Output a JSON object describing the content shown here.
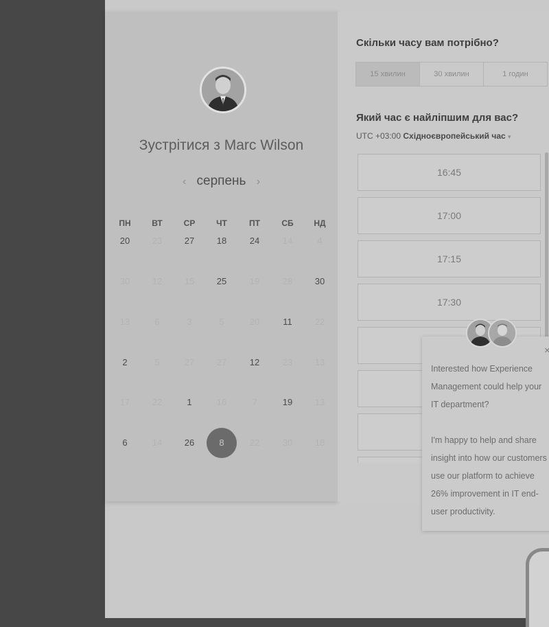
{
  "calendar": {
    "title": "Зустрітися з Marc Wilson",
    "month": "серпень",
    "prev_icon": "‹",
    "next_icon": "›",
    "weekdays": [
      "ПН",
      "ВТ",
      "СР",
      "ЧТ",
      "ПТ",
      "СБ",
      "НД"
    ],
    "rows": [
      [
        {
          "d": "20",
          "a": true
        },
        {
          "d": "23",
          "a": false
        },
        {
          "d": "27",
          "a": true
        },
        {
          "d": "18",
          "a": true
        },
        {
          "d": "24",
          "a": true
        },
        {
          "d": "14",
          "a": false
        },
        {
          "d": "4",
          "a": false
        }
      ],
      [
        {
          "d": "30",
          "a": false
        },
        {
          "d": "12",
          "a": false
        },
        {
          "d": "15",
          "a": false
        },
        {
          "d": "25",
          "a": true
        },
        {
          "d": "19",
          "a": false
        },
        {
          "d": "28",
          "a": false
        },
        {
          "d": "30",
          "a": true
        }
      ],
      [
        {
          "d": "13",
          "a": false
        },
        {
          "d": "6",
          "a": false
        },
        {
          "d": "3",
          "a": false
        },
        {
          "d": "5",
          "a": false
        },
        {
          "d": "20",
          "a": false
        },
        {
          "d": "11",
          "a": true
        },
        {
          "d": "22",
          "a": false
        }
      ],
      [
        {
          "d": "2",
          "a": true
        },
        {
          "d": "5",
          "a": false
        },
        {
          "d": "27",
          "a": false
        },
        {
          "d": "27",
          "a": false
        },
        {
          "d": "12",
          "a": true
        },
        {
          "d": "23",
          "a": false
        },
        {
          "d": "13",
          "a": false
        }
      ],
      [
        {
          "d": "17",
          "a": false
        },
        {
          "d": "22",
          "a": false
        },
        {
          "d": "1",
          "a": true
        },
        {
          "d": "16",
          "a": false
        },
        {
          "d": "7",
          "a": false
        },
        {
          "d": "19",
          "a": true
        },
        {
          "d": "13",
          "a": false
        }
      ],
      [
        {
          "d": "6",
          "a": true
        },
        {
          "d": "14",
          "a": false
        },
        {
          "d": "26",
          "a": true
        },
        {
          "d": "8",
          "a": true,
          "sel": true
        },
        {
          "d": "22",
          "a": false
        },
        {
          "d": "30",
          "a": false
        },
        {
          "d": "18",
          "a": false
        }
      ]
    ]
  },
  "times": {
    "question_duration": "Скільки часу вам потрібно?",
    "durations": [
      {
        "label": "15 хвилин",
        "selected": true
      },
      {
        "label": "30 хвилин",
        "selected": false
      },
      {
        "label": "1 годин",
        "selected": false
      }
    ],
    "question_time": "Який час є найліпшим для вас?",
    "tz_offset": "UTC +03:00",
    "tz_name": "Східноєвропейський час",
    "tz_caret": "▾",
    "slots": [
      "16:45",
      "17:00",
      "17:15",
      "17:30",
      "",
      "",
      "",
      ""
    ]
  },
  "chat": {
    "close": "×",
    "message": "Interested how Experience Management could help your IT department?\n\nI'm happy to help and share insight into how our customers use our platform to achieve 26% improvement in IT end-user productivity."
  }
}
